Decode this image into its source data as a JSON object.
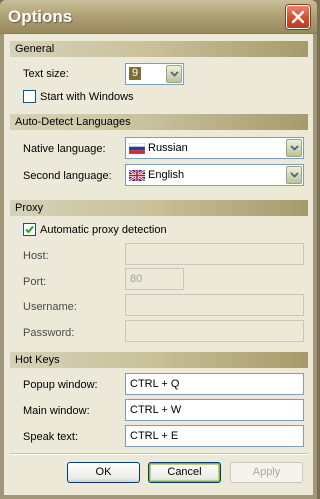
{
  "window": {
    "title": "Options"
  },
  "general": {
    "header": "General",
    "text_size_label": "Text size:",
    "text_size_value": "9",
    "start_with_windows_label": "Start with Windows",
    "start_with_windows_checked": false
  },
  "auto_detect": {
    "header": "Auto-Detect Languages",
    "native_label": "Native language:",
    "native_value": "Russian",
    "second_label": "Second language:",
    "second_value": "English"
  },
  "proxy": {
    "header": "Proxy",
    "auto_label": "Automatic proxy detection",
    "auto_checked": true,
    "host_label": "Host:",
    "host_value": "",
    "port_label": "Port:",
    "port_value": "80",
    "username_label": "Username:",
    "username_value": "",
    "password_label": "Password:",
    "password_value": ""
  },
  "hotkeys": {
    "header": "Hot Keys",
    "popup_label": "Popup window:",
    "popup_value": "CTRL + Q",
    "main_label": "Main window:",
    "main_value": "CTRL + W",
    "speak_label": "Speak text:",
    "speak_value": "CTRL + E"
  },
  "buttons": {
    "ok": "OK",
    "cancel": "Cancel",
    "apply": "Apply"
  },
  "colors": {
    "titlebar": "#a4956a",
    "client": "#ece9d8",
    "accent": "#7b6d36"
  }
}
